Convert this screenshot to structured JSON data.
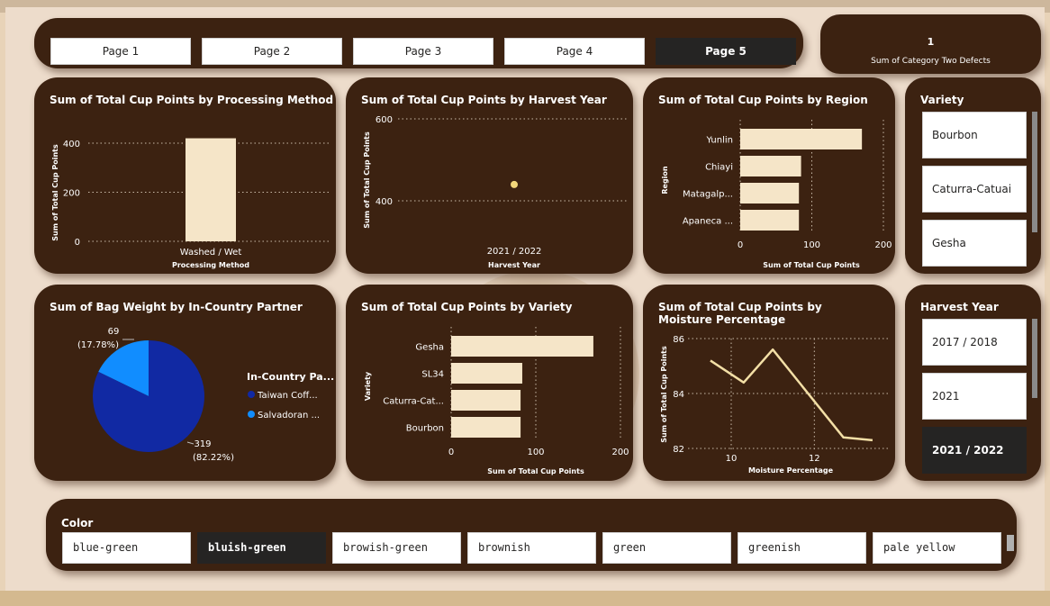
{
  "colors": {
    "panel_bg": "#3c2211",
    "bar_fill": "#f5e5c8",
    "line": "#f3dfa6",
    "point": "#f3d77a",
    "pie_dark": "#1129a3",
    "pie_light": "#118dff",
    "selected": "#252423"
  },
  "nav": {
    "pages": [
      {
        "label": "Page 1",
        "active": false
      },
      {
        "label": "Page 2",
        "active": false
      },
      {
        "label": "Page 3",
        "active": false
      },
      {
        "label": "Page 4",
        "active": false
      },
      {
        "label": "Page 5",
        "active": true
      }
    ]
  },
  "kpi_card": {
    "value": "1",
    "label": "Sum of Category Two Defects"
  },
  "variety_slicer": {
    "title": "Variety",
    "items": [
      "Bourbon",
      "Caturra-Catuai",
      "Gesha"
    ],
    "selected": []
  },
  "harvest_slicer": {
    "title": "Harvest Year",
    "items": [
      "2017 / 2018",
      "2021",
      "2021 / 2022"
    ],
    "selected": [
      "2021 / 2022"
    ]
  },
  "color_slicer": {
    "title": "Color",
    "items": [
      "blue-green",
      "bluish-green",
      "browish-green",
      "brownish",
      "green",
      "greenish",
      "pale yellow"
    ],
    "selected": [
      "bluish-green"
    ]
  },
  "chart_data": [
    {
      "id": "processing",
      "type": "bar",
      "title": "Sum of Total Cup Points by Processing Method",
      "xlabel": "Processing Method",
      "ylabel": "Sum of Total Cup Points",
      "categories": [
        "Washed / Wet"
      ],
      "values": [
        420
      ],
      "ylim": [
        0,
        400
      ],
      "yticks": [
        0,
        200,
        400
      ],
      "grid": true
    },
    {
      "id": "harvest",
      "type": "scatter",
      "title": "Sum of Total Cup Points by Harvest Year",
      "xlabel": "Harvest Year",
      "ylabel": "Sum of Total Cup Points",
      "categories": [
        "2021 / 2022"
      ],
      "values": [
        420
      ],
      "ylim": [
        400,
        600
      ],
      "yticks": [
        400,
        600
      ],
      "grid": true
    },
    {
      "id": "region",
      "type": "bar",
      "orientation": "horizontal",
      "title": "Sum of Total Cup Points by Region",
      "xlabel": "Sum of Total Cup Points",
      "ylabel": "Region",
      "categories": [
        "Yunlin",
        "Chiayi",
        "Matagalp...",
        "Apaneca ..."
      ],
      "values": [
        170,
        85,
        82,
        82
      ],
      "xlim": [
        0,
        200
      ],
      "xticks": [
        0,
        100,
        200
      ],
      "grid": true
    },
    {
      "id": "partner",
      "type": "pie",
      "title": "Sum of Bag Weight by In-Country Partner",
      "legend_title": "In-Country Pa...",
      "legend_position": "right",
      "slices": [
        {
          "name": "Taiwan Coff...",
          "value": 319,
          "label_value": "319",
          "label_pct": "(82.22%)",
          "color": "#1129a3"
        },
        {
          "name": "Salvadoran ...",
          "value": 69,
          "label_value": "69",
          "label_pct": "(17.78%)",
          "color": "#118dff"
        }
      ]
    },
    {
      "id": "variety",
      "type": "bar",
      "orientation": "horizontal",
      "title": "Sum of Total Cup Points by Variety",
      "xlabel": "Sum of Total Cup Points",
      "ylabel": "Variety",
      "categories": [
        "Gesha",
        "SL34",
        "Caturra-Cat...",
        "Bourbon"
      ],
      "values": [
        168,
        84,
        82,
        82
      ],
      "xlim": [
        0,
        200
      ],
      "xticks": [
        0,
        100,
        200
      ],
      "grid": true
    },
    {
      "id": "moisture",
      "type": "line",
      "title": "Sum of Total Cup Points by Moisture Percentage",
      "xlabel": "Moisture Percentage",
      "ylabel": "Sum of Total Cup Points",
      "x": [
        9.5,
        10.3,
        11.0,
        12.7,
        13.4
      ],
      "y": [
        85.2,
        84.4,
        85.6,
        82.4,
        82.3
      ],
      "xlim": [
        8.7,
        13.9
      ],
      "ylim": [
        82,
        86
      ],
      "xticks": [
        10,
        12
      ],
      "yticks": [
        82,
        84,
        86
      ],
      "grid": true
    }
  ]
}
